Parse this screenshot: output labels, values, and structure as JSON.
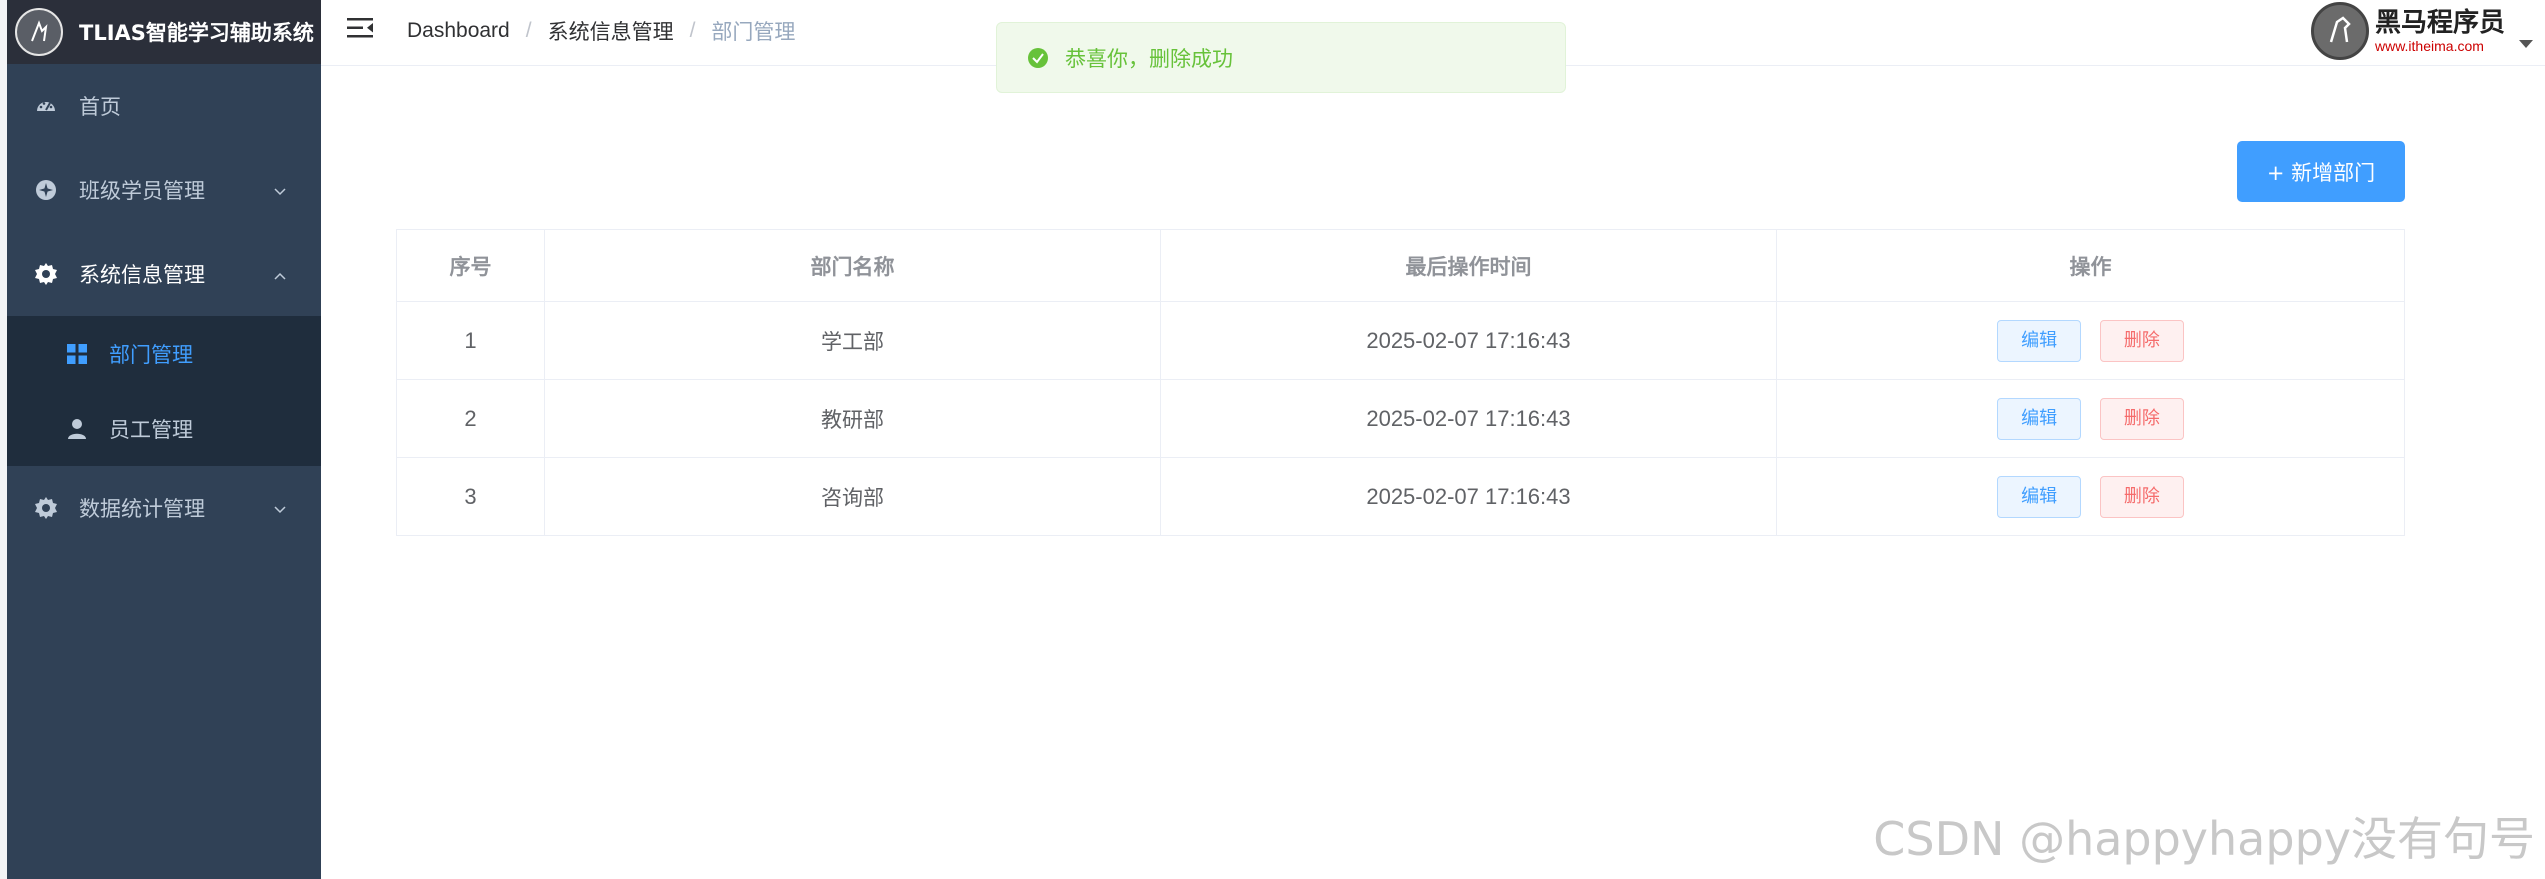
{
  "app": {
    "title": "TLIAS智能学习辅助系统"
  },
  "sidebar": {
    "items": [
      {
        "label": "首页",
        "icon": "dashboard-icon"
      },
      {
        "label": "班级学员管理",
        "icon": "compass-icon"
      },
      {
        "label": "系统信息管理",
        "icon": "gear-icon"
      },
      {
        "label": "数据统计管理",
        "icon": "gear-icon"
      }
    ],
    "subitems": [
      {
        "label": "部门管理",
        "icon": "grid-icon"
      },
      {
        "label": "员工管理",
        "icon": "user-icon"
      }
    ]
  },
  "breadcrumb": [
    "Dashboard",
    "系统信息管理",
    "部门管理"
  ],
  "breadcrumb_separator": "/",
  "brand_logo": {
    "main": "黑马程序员",
    "sub": "www.itheima.com"
  },
  "toast": {
    "message": "恭喜你，删除成功",
    "color": "#67c23a"
  },
  "toolbar": {
    "add_label": "+ 新增部门"
  },
  "table": {
    "headers": [
      "序号",
      "部门名称",
      "最后操作时间",
      "操作"
    ],
    "rows": [
      {
        "index": "1",
        "name": "学工部",
        "time": "2025-02-07 17:16:43"
      },
      {
        "index": "2",
        "name": "教研部",
        "time": "2025-02-07 17:16:43"
      },
      {
        "index": "3",
        "name": "咨询部",
        "time": "2025-02-07 17:16:43"
      }
    ],
    "edit_label": "编辑",
    "delete_label": "删除"
  },
  "watermark": "CSDN @happyhappy没有句号",
  "colors": {
    "sidebar_bg": "#304156",
    "accent": "#409eff",
    "danger": "#f56c6c"
  }
}
